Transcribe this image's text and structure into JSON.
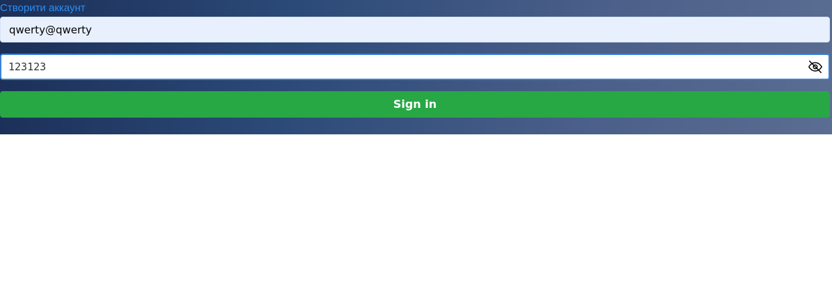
{
  "header": {
    "create_account_link": "Створити аккаунт"
  },
  "form": {
    "email": {
      "value": "qwerty@qwerty"
    },
    "password": {
      "value": "123123",
      "toggle_icon": "eye-slash-icon"
    },
    "submit_label": "Sign in"
  },
  "colors": {
    "link": "#2d8cf0",
    "submit_bg": "#28a745",
    "hero_start": "#1b2f57",
    "hero_end": "#5a6d92",
    "focus_border": "#3b82d6",
    "autofill_bg": "#e8f0fe"
  }
}
